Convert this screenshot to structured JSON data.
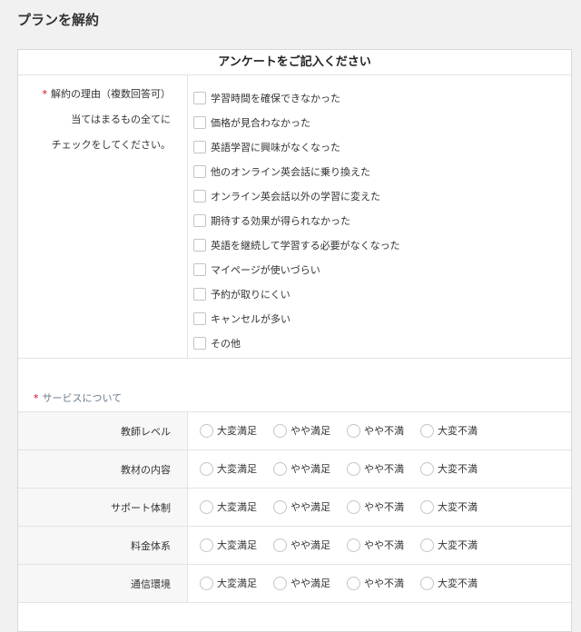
{
  "page": {
    "title": "プランを解約"
  },
  "survey": {
    "header": "アンケートをご記入ください",
    "reason": {
      "required_mark": "*",
      "label_lines": [
        "解約の理由（複数回答可）",
        "当てはまるもの全てに",
        "チェックをしてください。"
      ],
      "options": [
        "学習時間を確保できなかった",
        "価格が見合わなかった",
        "英語学習に興味がなくなった",
        "他のオンライン英会話に乗り換えた",
        "オンライン英会話以外の学習に変えた",
        "期待する効果が得られなかった",
        "英語を継続して学習する必要がなくなった",
        "マイページが使いづらい",
        "予約が取りにくい",
        "キャンセルが多い",
        "その他"
      ]
    },
    "service": {
      "required_mark": "*",
      "label": "サービスについて",
      "scale": [
        "大変満足",
        "やや満足",
        "やや不満",
        "大変不満"
      ],
      "rows": [
        "教師レベル",
        "教材の内容",
        "サポート体制",
        "料金体系",
        "通信環境"
      ]
    }
  }
}
